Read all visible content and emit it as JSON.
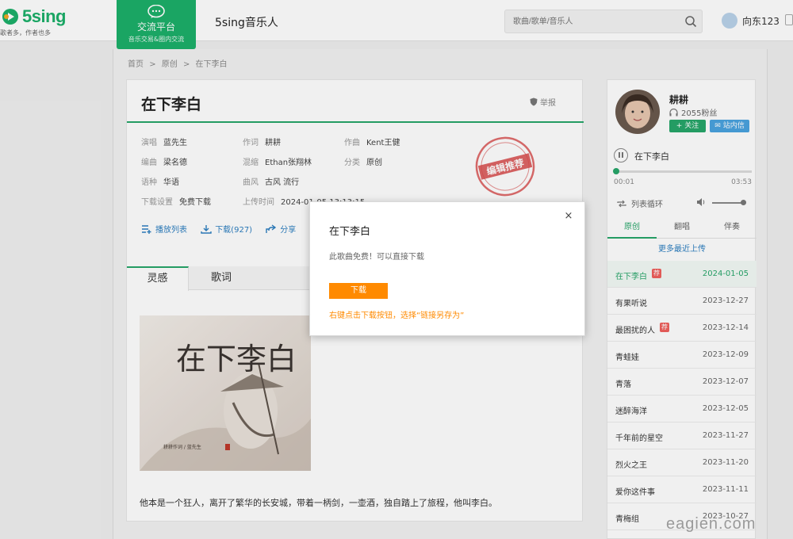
{
  "header": {
    "logo_text": "5sing",
    "slogan": "歌者多，作者也多",
    "community_title": "交流平台",
    "community_sub": "音乐交易&圈内交流",
    "site_name": "5sing音乐人",
    "search_placeholder": "歌曲/歌单/音乐人",
    "user_name": "向东123"
  },
  "breadcrumb": [
    "首页",
    ">",
    "原创",
    ">",
    "在下李白"
  ],
  "song": {
    "title": "在下李白",
    "report_label": "举报",
    "meta": [
      {
        "k": "演唱",
        "v": "蓝先生"
      },
      {
        "k": "作词",
        "v": "耕耕"
      },
      {
        "k": "作曲",
        "v": "Kent王健"
      },
      {
        "k": "编曲",
        "v": "梁名德"
      },
      {
        "k": "混缩",
        "v": "Ethan张翔林"
      },
      {
        "k": "分类",
        "v": "原创"
      },
      {
        "k": "语种",
        "v": "华语"
      },
      {
        "k": "曲风",
        "v": "古风 流行"
      },
      {
        "k": "下载设置",
        "v": "免费下载"
      },
      {
        "k": "上传时间",
        "v": "2024-01-05 13:13:15"
      }
    ],
    "stamp_text": "编辑推荐",
    "actions": [
      {
        "icon": "playlist-add-icon",
        "label": "播放列表"
      },
      {
        "icon": "download-icon",
        "label": "下载(927)"
      },
      {
        "icon": "share-icon",
        "label": "分享"
      }
    ]
  },
  "detail": {
    "tabs": [
      "灵感",
      "歌词"
    ],
    "cover_title": "在下李白",
    "cover_credit": "耕耕作词 / 蓝先生",
    "story": "他本是一个狂人，离开了繁华的长安城，带着一柄剑，一壶酒，独自踏上了旅程，他叫李白。"
  },
  "sidebar": {
    "name": "耕耕",
    "fans": "2055粉丝",
    "follow_label": "+ 关注",
    "message_label": "✉ 站内信",
    "player": {
      "title": "在下李白",
      "current": "00:01",
      "total": "03:53",
      "progress": 0.02,
      "loop_label": "列表循环",
      "volume": 0.85
    },
    "tabs": [
      "原创",
      "翻唱",
      "伴奏"
    ],
    "more_link": "更多最近上传",
    "songs": [
      {
        "name": "在下李白",
        "date": "2024-01-05",
        "hot": true,
        "current": true
      },
      {
        "name": "有果听说",
        "date": "2023-12-27",
        "hot": false,
        "current": false
      },
      {
        "name": "最困扰的人",
        "date": "2023-12-14",
        "hot": true,
        "current": false
      },
      {
        "name": "青蛙娃",
        "date": "2023-12-09",
        "hot": false,
        "current": false
      },
      {
        "name": "青落",
        "date": "2023-12-07",
        "hot": false,
        "current": false
      },
      {
        "name": "迷醉海洋",
        "date": "2023-12-05",
        "hot": false,
        "current": false
      },
      {
        "name": "千年前的星空",
        "date": "2023-11-27",
        "hot": false,
        "current": false
      },
      {
        "name": "烈火之王",
        "date": "2023-11-20",
        "hot": false,
        "current": false
      },
      {
        "name": "爱你这件事",
        "date": "2023-11-11",
        "hot": false,
        "current": false
      },
      {
        "name": "青梅组",
        "date": "2023-10-27",
        "hot": false,
        "current": false
      }
    ],
    "hot_badge": "荐"
  },
  "modal": {
    "title": "在下李白",
    "close": "×",
    "message": "此歌曲免费！可以直接下载",
    "button": "下载",
    "tip": "右键点击下载按钮，选择“链接另存为”"
  },
  "watermark": "eagien.com",
  "colors": {
    "brand": "#1cb06a",
    "accent": "#ff8a00",
    "link": "#2d7fc1"
  }
}
